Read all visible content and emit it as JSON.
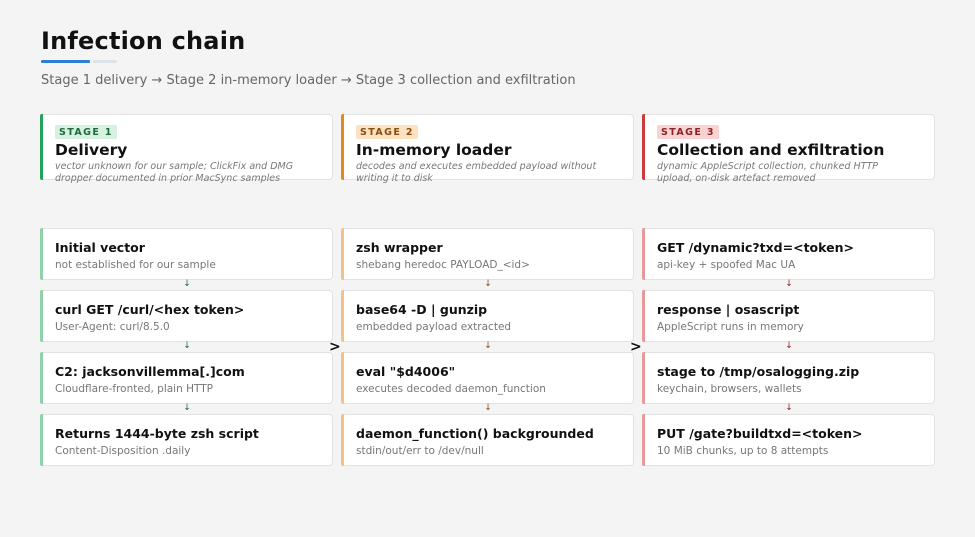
{
  "page": {
    "title": "Infection chain",
    "subtitle": "Stage 1 delivery → Stage 2 in-memory loader → Stage 3 collection and exfiltration"
  },
  "colors": {
    "stage1": "#22a35a",
    "stage2": "#e08a1e",
    "stage3": "#cc3b3b",
    "accent_underline": "#2d7fd6"
  },
  "stages": [
    {
      "pill": "STAGE 1",
      "name": "Delivery",
      "desc": "vector unknown for our sample; ClickFix and DMG dropper documented in prior MacSync samples",
      "steps": [
        {
          "title": "Initial vector",
          "desc": "not established for our sample"
        },
        {
          "title": "curl GET /curl/<hex token>",
          "desc": "User-Agent: curl/8.5.0"
        },
        {
          "title": "C2: jacksonvillemma[.]com",
          "desc": "Cloudflare-fronted, plain HTTP"
        },
        {
          "title": "Returns 1444-byte zsh script",
          "desc": "Content-Disposition .daily"
        }
      ]
    },
    {
      "pill": "STAGE 2",
      "name": "In-memory loader",
      "desc": "decodes and executes embedded payload without writing it to disk",
      "steps": [
        {
          "title": "zsh wrapper",
          "desc": "shebang heredoc PAYLOAD_<id>"
        },
        {
          "title": "base64 -D | gunzip",
          "desc": "embedded payload extracted"
        },
        {
          "title": "eval \"$d4006\"",
          "desc": "executes decoded daemon_function"
        },
        {
          "title": "daemon_function() backgrounded",
          "desc": "stdin/out/err to /dev/null"
        }
      ]
    },
    {
      "pill": "STAGE 3",
      "name": "Collection and exfiltration",
      "desc": "dynamic AppleScript collection, chunked HTTP upload, on-disk artefact removed",
      "steps": [
        {
          "title": "GET /dynamic?txd=<token>",
          "desc": "api-key + spoofed Mac UA"
        },
        {
          "title": "response | osascript",
          "desc": "AppleScript runs in memory"
        },
        {
          "title": "stage to /tmp/osalogging.zip",
          "desc": "keychain, browsers, wallets"
        },
        {
          "title": "PUT /gate?buildtxd=<token>",
          "desc": "10 MiB chunks, up to 8 attempts"
        }
      ]
    }
  ]
}
